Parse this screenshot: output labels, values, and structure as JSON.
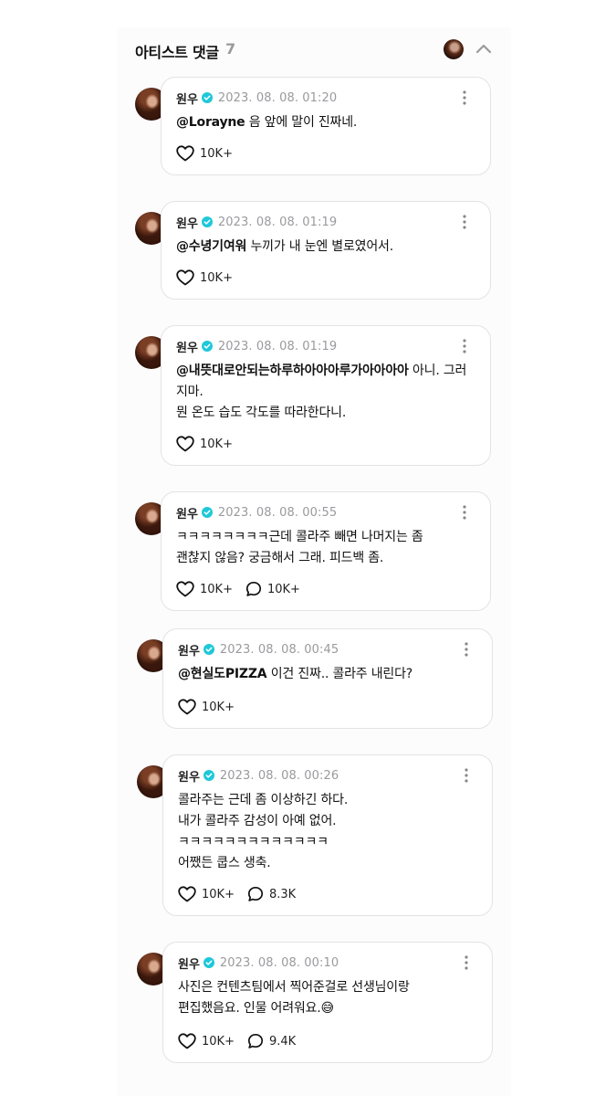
{
  "header": {
    "title": "아티스트 댓글",
    "count": "7"
  },
  "comments": [
    {
      "author": "원우",
      "date": "2023. 08. 08. 01:20",
      "mention": "@Lorayne",
      "lines": [
        "음 앞에 말이 진짜네."
      ],
      "likes": "10K+",
      "replies": ""
    },
    {
      "author": "원우",
      "date": "2023. 08. 08. 01:19",
      "mention": "@수녕기여워",
      "lines": [
        "누끼가 내 눈엔 별로였어서."
      ],
      "likes": "10K+",
      "replies": ""
    },
    {
      "author": "원우",
      "date": "2023. 08. 08. 01:19",
      "mention": "@내뜻대로안되는하루하아아아루가아아아아",
      "lines": [
        "아니. 그러지마.",
        "뭔 온도 습도 각도를 따라한다니."
      ],
      "likes": "10K+",
      "replies": ""
    },
    {
      "author": "원우",
      "date": "2023. 08. 08. 00:55",
      "mention": "",
      "lines": [
        "ㅋㅋㅋㅋㅋㅋㅋㅋ근데 콜라주 빼면 나머지는 좀",
        "괜찮지 않음? 궁금해서 그래. 피드백 좀."
      ],
      "likes": "10K+",
      "replies": "10K+"
    },
    {
      "author": "원우",
      "date": "2023. 08. 08. 00:45",
      "mention": "@현실도PIZZA",
      "lines": [
        "이건 진짜.. 콜라주 내린다?"
      ],
      "likes": "10K+",
      "replies": ""
    },
    {
      "author": "원우",
      "date": "2023. 08. 08. 00:26",
      "mention": "",
      "lines": [
        "콜라주는 근데 좀 이상하긴 하다.",
        "내가 콜라주 감성이 아예 없어.",
        "ㅋㅋㅋㅋㅋㅋㅋㅋㅋㅋㅋㅋㅋ",
        "어쨌든 쿱스 생축."
      ],
      "likes": "10K+",
      "replies": "8.3K"
    },
    {
      "author": "원우",
      "date": "2023. 08. 08. 00:10",
      "mention": "",
      "lines": [
        "사진은 컨텐츠팀에서 찍어준걸로 선생님이랑",
        "편집했음요. 인물 어려워요.😅"
      ],
      "likes": "10K+",
      "replies": "9.4K"
    }
  ]
}
